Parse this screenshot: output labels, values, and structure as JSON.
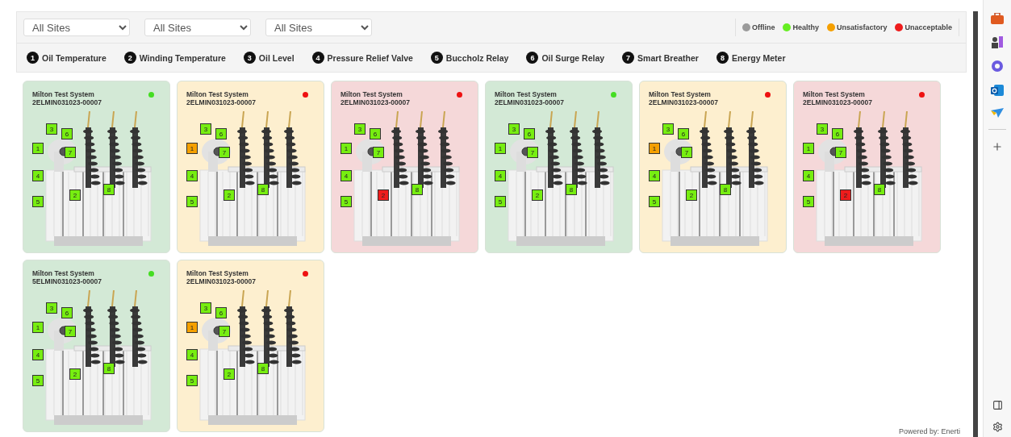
{
  "filters": [
    {
      "value": "All Sites"
    },
    {
      "value": "All Sites"
    },
    {
      "value": "All Sites"
    }
  ],
  "legend": [
    {
      "label": "Offline",
      "color": "#9a9a9a"
    },
    {
      "label": "Healthy",
      "color": "#66ee22"
    },
    {
      "label": "Unsatisfactory",
      "color": "#f5a000"
    },
    {
      "label": "Unacceptable",
      "color": "#ee1c1c"
    }
  ],
  "sensors": [
    {
      "number": "1",
      "label": "Oil Temperature"
    },
    {
      "number": "2",
      "label": "Winding Temperature"
    },
    {
      "number": "3",
      "label": "Oil Level"
    },
    {
      "number": "4",
      "label": "Pressure Relief Valve"
    },
    {
      "number": "5",
      "label": "Buccholz Relay"
    },
    {
      "number": "6",
      "label": "Oil Surge Relay"
    },
    {
      "number": "7",
      "label": "Smart Breather"
    },
    {
      "number": "8",
      "label": "Energy Meter"
    }
  ],
  "cards": [
    {
      "title": "Milton Test System",
      "serial": "2ELMIN031023-00007",
      "color": "#d3e9d6",
      "dot": {
        "color": "#44dd22"
      },
      "markers": [
        {
          "label": "1",
          "color": "#77ee11"
        },
        {
          "label": "2",
          "color": "#77ee11"
        },
        {
          "label": "3",
          "color": "#77ee11"
        },
        {
          "label": "4",
          "color": "#77ee11"
        },
        {
          "label": "5",
          "color": "#77ee11"
        },
        {
          "label": "6",
          "color": "#77ee11"
        },
        {
          "label": "7",
          "color": "#77ee11"
        },
        {
          "label": "8",
          "color": "#77ee11"
        }
      ]
    },
    {
      "title": "Milton Test System",
      "serial": "2ELMIN031023-00007",
      "color": "#fdefcf",
      "dot": {
        "color": "#ee1111"
      },
      "markers": [
        {
          "label": "1",
          "color": "#f5a000"
        },
        {
          "label": "2",
          "color": "#77ee11"
        },
        {
          "label": "3",
          "color": "#77ee11"
        },
        {
          "label": "4",
          "color": "#77ee11"
        },
        {
          "label": "5",
          "color": "#77ee11"
        },
        {
          "label": "6",
          "color": "#77ee11"
        },
        {
          "label": "7",
          "color": "#77ee11"
        },
        {
          "label": "8",
          "color": "#77ee11"
        }
      ]
    },
    {
      "title": "Milton Test System",
      "serial": "2ELMIN031023-00007",
      "color": "#f5d8d9",
      "dot": {
        "color": "#ee1111"
      },
      "markers": [
        {
          "label": "1",
          "color": "#77ee11"
        },
        {
          "label": "2",
          "color": "#ee1c1c"
        },
        {
          "label": "3",
          "color": "#77ee11"
        },
        {
          "label": "4",
          "color": "#77ee11"
        },
        {
          "label": "5",
          "color": "#77ee11"
        },
        {
          "label": "6",
          "color": "#77ee11"
        },
        {
          "label": "7",
          "color": "#77ee11"
        },
        {
          "label": "8",
          "color": "#77ee11"
        }
      ]
    },
    {
      "title": "Milton Test System",
      "serial": "2ELMIN031023-00007",
      "color": "#d3e9d6",
      "dot": {
        "color": "#44dd22"
      },
      "markers": [
        {
          "label": "1",
          "color": "#77ee11"
        },
        {
          "label": "2",
          "color": "#77ee11"
        },
        {
          "label": "3",
          "color": "#77ee11"
        },
        {
          "label": "4",
          "color": "#77ee11"
        },
        {
          "label": "5",
          "color": "#77ee11"
        },
        {
          "label": "6",
          "color": "#77ee11"
        },
        {
          "label": "7",
          "color": "#77ee11"
        },
        {
          "label": "8",
          "color": "#77ee11"
        }
      ]
    },
    {
      "title": "Milton Test System",
      "serial": "2ELMIN031023-00007",
      "color": "#fdefcf",
      "dot": {
        "color": "#ee1111"
      },
      "markers": [
        {
          "label": "1",
          "color": "#f5a000"
        },
        {
          "label": "2",
          "color": "#77ee11"
        },
        {
          "label": "3",
          "color": "#77ee11"
        },
        {
          "label": "4",
          "color": "#77ee11"
        },
        {
          "label": "5",
          "color": "#77ee11"
        },
        {
          "label": "6",
          "color": "#77ee11"
        },
        {
          "label": "7",
          "color": "#77ee11"
        },
        {
          "label": "8",
          "color": "#77ee11"
        }
      ]
    },
    {
      "title": "Milton Test System",
      "serial": "2ELMIN031023-00007",
      "color": "#f5d8d9",
      "dot": {
        "color": "#ee1111"
      },
      "markers": [
        {
          "label": "1",
          "color": "#77ee11"
        },
        {
          "label": "2",
          "color": "#ee1c1c"
        },
        {
          "label": "3",
          "color": "#77ee11"
        },
        {
          "label": "4",
          "color": "#77ee11"
        },
        {
          "label": "5",
          "color": "#77ee11"
        },
        {
          "label": "6",
          "color": "#77ee11"
        },
        {
          "label": "7",
          "color": "#77ee11"
        },
        {
          "label": "8",
          "color": "#77ee11"
        }
      ]
    },
    {
      "title": "Milton Test System",
      "serial": "5ELMIN031023-00007",
      "color": "#d3e9d6",
      "dot": {
        "color": "#44dd22"
      },
      "markers": [
        {
          "label": "1",
          "color": "#77ee11"
        },
        {
          "label": "2",
          "color": "#77ee11"
        },
        {
          "label": "3",
          "color": "#77ee11"
        },
        {
          "label": "4",
          "color": "#77ee11"
        },
        {
          "label": "5",
          "color": "#77ee11"
        },
        {
          "label": "6",
          "color": "#77ee11"
        },
        {
          "label": "7",
          "color": "#77ee11"
        },
        {
          "label": "8",
          "color": "#77ee11"
        }
      ]
    },
    {
      "title": "Milton Test System",
      "serial": "2ELMIN031023-00007",
      "color": "#fdefcf",
      "dot": {
        "color": "#ee1111"
      },
      "markers": [
        {
          "label": "1",
          "color": "#f5a000"
        },
        {
          "label": "2",
          "color": "#77ee11"
        },
        {
          "label": "3",
          "color": "#77ee11"
        },
        {
          "label": "4",
          "color": "#77ee11"
        },
        {
          "label": "5",
          "color": "#77ee11"
        },
        {
          "label": "6",
          "color": "#77ee11"
        },
        {
          "label": "7",
          "color": "#77ee11"
        },
        {
          "label": "8",
          "color": "#77ee11"
        }
      ]
    }
  ],
  "footer": "Powered by: Enerti"
}
